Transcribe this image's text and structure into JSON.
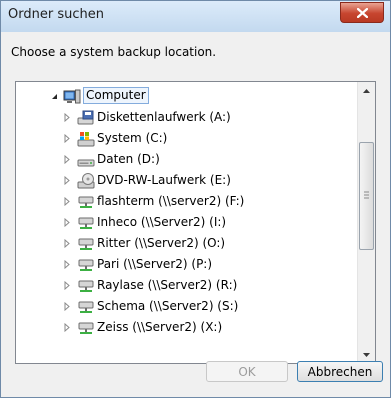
{
  "window": {
    "title": "Ordner suchen"
  },
  "dialog": {
    "prompt": "Choose a system backup location."
  },
  "tree": {
    "root": {
      "label": "Computer",
      "icon": "computer-icon"
    },
    "items": [
      {
        "label": "Diskettenlaufwerk (A:)",
        "icon": "floppy-drive-icon"
      },
      {
        "label": "System (C:)",
        "icon": "system-drive-icon"
      },
      {
        "label": "Daten (D:)",
        "icon": "hard-drive-icon"
      },
      {
        "label": "DVD-RW-Laufwerk (E:)",
        "icon": "dvd-drive-icon"
      },
      {
        "label": "flashterm (\\\\server2) (F:)",
        "icon": "network-drive-icon"
      },
      {
        "label": "Inheco (\\\\Server2) (I:)",
        "icon": "network-drive-icon"
      },
      {
        "label": "Ritter (\\\\Server2) (O:)",
        "icon": "network-drive-icon"
      },
      {
        "label": "Pari (\\\\Server2) (P:)",
        "icon": "network-drive-icon"
      },
      {
        "label": "Raylase (\\\\Server2) (R:)",
        "icon": "network-drive-icon"
      },
      {
        "label": "Schema (\\\\Server2) (S:)",
        "icon": "network-drive-icon"
      },
      {
        "label": "Zeiss (\\\\Server2) (X:)",
        "icon": "network-drive-icon"
      }
    ]
  },
  "buttons": {
    "ok": "OK",
    "cancel": "Abbrechen"
  },
  "colors": {
    "selection_border": "#84acdd",
    "close_button": "#c7452f"
  }
}
